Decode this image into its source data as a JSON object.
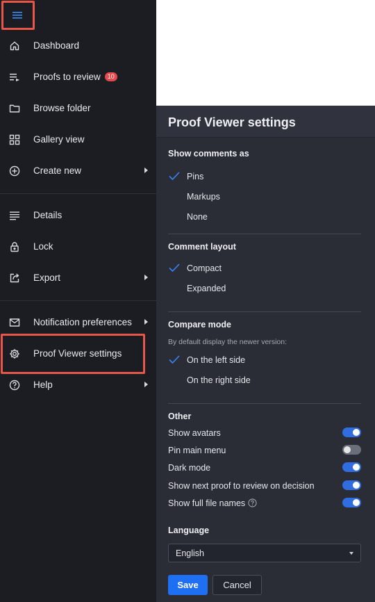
{
  "sidebar": {
    "menu_icon": "hamburger-menu-icon",
    "items": [
      {
        "label": "Dashboard",
        "icon": "home-icon"
      },
      {
        "label": "Proofs to review",
        "icon": "playlist-icon",
        "badge": "10"
      },
      {
        "label": "Browse folder",
        "icon": "folder-icon"
      },
      {
        "label": "Gallery view",
        "icon": "grid-icon"
      },
      {
        "label": "Create new",
        "icon": "plus-circle-icon",
        "submenu": true
      },
      {
        "label": "Details",
        "icon": "lines-icon"
      },
      {
        "label": "Lock",
        "icon": "lock-icon"
      },
      {
        "label": "Export",
        "icon": "export-icon",
        "submenu": true
      },
      {
        "label": "Notification preferences",
        "icon": "mail-icon",
        "submenu": true
      },
      {
        "label": "Proof Viewer settings",
        "icon": "gear-icon"
      },
      {
        "label": "Help",
        "icon": "help-circle-icon",
        "submenu": true
      }
    ]
  },
  "panel": {
    "title": "Proof Viewer settings",
    "show_comments": {
      "title": "Show comments as",
      "options": [
        "Pins",
        "Markups",
        "None"
      ],
      "selected": "Pins"
    },
    "comment_layout": {
      "title": "Comment layout",
      "options": [
        "Compact",
        "Expanded"
      ],
      "selected": "Compact"
    },
    "compare_mode": {
      "title": "Compare mode",
      "subtitle": "By default display the newer version:",
      "options": [
        "On the left side",
        "On the right side"
      ],
      "selected": "On the left side"
    },
    "other": {
      "title": "Other",
      "toggles": [
        {
          "label": "Show avatars",
          "on": true
        },
        {
          "label": "Pin main menu",
          "on": false
        },
        {
          "label": "Dark mode",
          "on": true
        },
        {
          "label": "Show next proof to review on decision",
          "on": true
        },
        {
          "label": "Show full file names",
          "on": true,
          "help": true
        }
      ]
    },
    "language": {
      "title": "Language",
      "value": "English"
    },
    "save_label": "Save",
    "cancel_label": "Cancel"
  },
  "colors": {
    "accent": "#2f6de1",
    "highlight": "#e8564a",
    "badge": "#e5484d"
  }
}
